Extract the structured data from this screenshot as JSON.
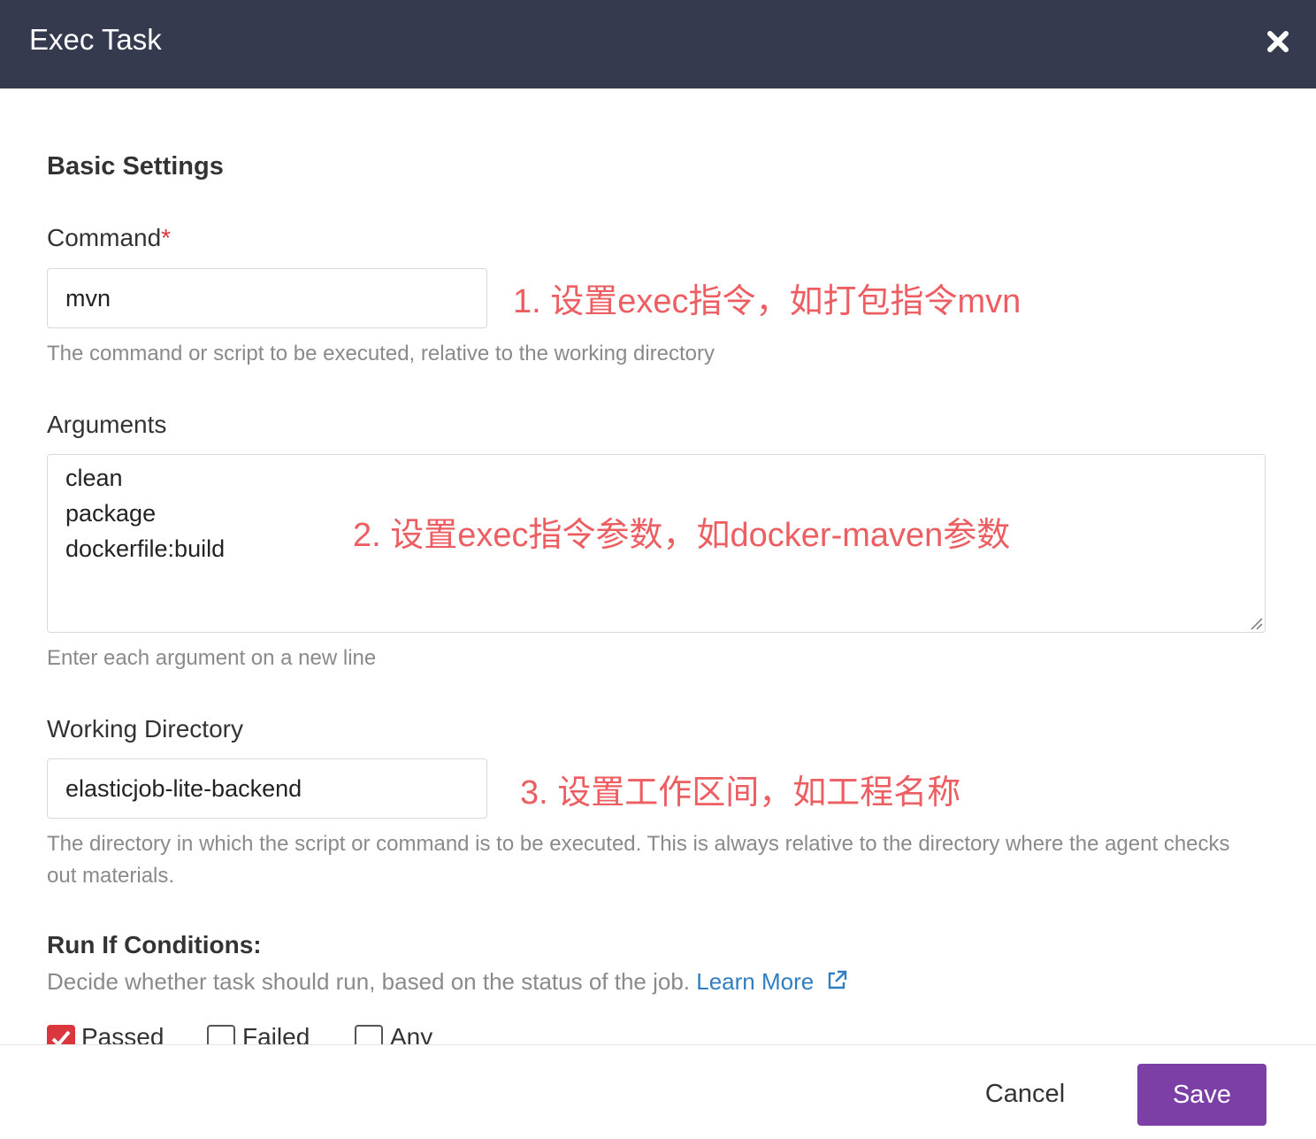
{
  "dialog": {
    "title": "Exec Task",
    "close_icon": "close-icon"
  },
  "basic": {
    "section_title": "Basic Settings"
  },
  "command": {
    "label": "Command",
    "required_mark": "*",
    "value": "mvn",
    "help": "The command or script to be executed, relative to the working directory",
    "annotation": "1. 设置exec指令，如打包指令mvn"
  },
  "arguments": {
    "label": "Arguments",
    "lines": [
      "clean",
      "package",
      "dockerfile:build"
    ],
    "help": "Enter each argument on a new line",
    "annotation": "2. 设置exec指令参数，如docker-maven参数"
  },
  "working_directory": {
    "label": "Working Directory",
    "value": "elasticjob-lite-backend",
    "help": "The directory in which the script or command is to be executed. This is always relative to the directory where the agent checks out materials.",
    "annotation": "3. 设置工作区间，如工程名称"
  },
  "run_if": {
    "title": "Run If Conditions:",
    "description": "Decide whether task should run, based on the status of the job.",
    "learn_more": "Learn More",
    "learn_more_icon": "external-link-icon",
    "options": [
      {
        "label": "Passed",
        "checked": true
      },
      {
        "label": "Failed",
        "checked": false
      },
      {
        "label": "Any",
        "checked": false
      }
    ]
  },
  "footer": {
    "cancel_label": "Cancel",
    "save_label": "Save"
  },
  "colors": {
    "header_bg": "#363a4f",
    "annotation": "#ec5e61",
    "link": "#2f7ec1",
    "save_button": "#7b3fa6",
    "required": "#d9363e"
  }
}
